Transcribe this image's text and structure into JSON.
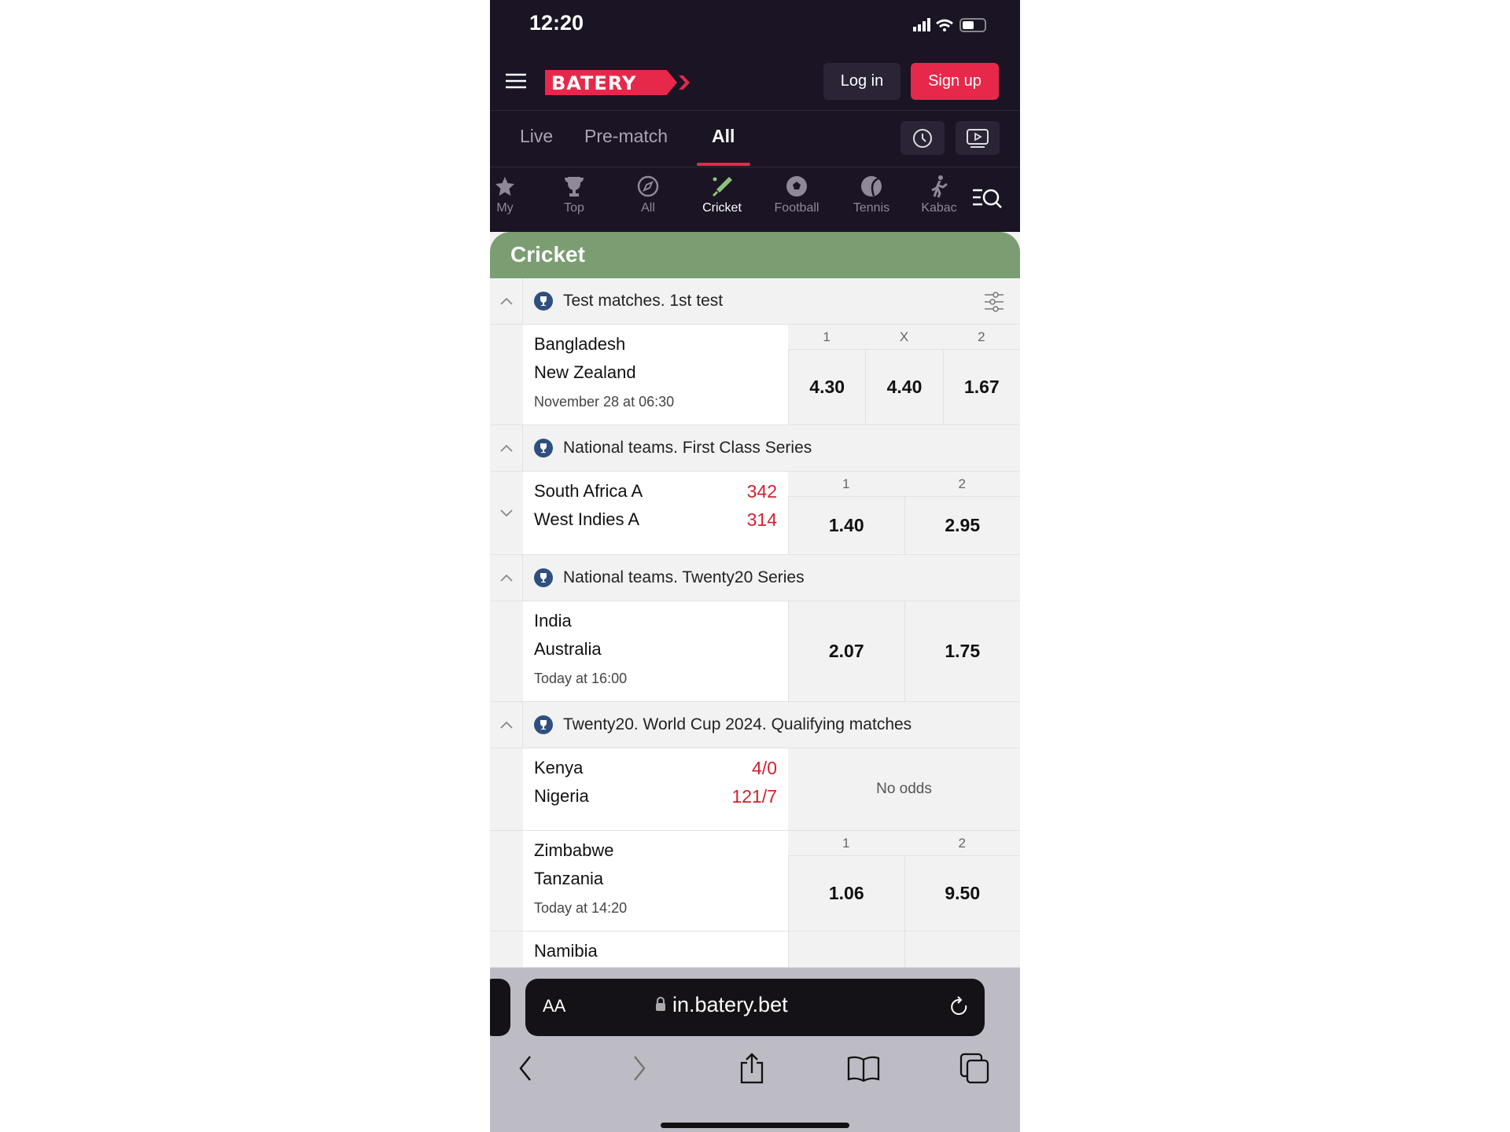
{
  "status": {
    "time": "12:20"
  },
  "header": {
    "logo": "BATERY",
    "login": "Log in",
    "signup": "Sign up"
  },
  "tabs": [
    {
      "label": "Live"
    },
    {
      "label": "Pre-match"
    },
    {
      "label": "All",
      "active": true
    }
  ],
  "sports": [
    {
      "label": "My",
      "icon": "star-icon"
    },
    {
      "label": "Top",
      "icon": "trophy-icon"
    },
    {
      "label": "All",
      "icon": "compass-icon"
    },
    {
      "label": "Cricket",
      "icon": "cricket-bat-icon",
      "active": true
    },
    {
      "label": "Football",
      "icon": "football-icon"
    },
    {
      "label": "Tennis",
      "icon": "tennis-ball-icon"
    },
    {
      "label": "Kabac",
      "icon": "kabaddi-icon"
    }
  ],
  "category": "Cricket",
  "sections": [
    {
      "title": "Test matches. 1st test",
      "filter": true,
      "matches": [
        {
          "team1": "Bangladesh",
          "team2": "New Zealand",
          "date": "November 28 at 06:30",
          "labels": [
            "1",
            "X",
            "2"
          ],
          "odds": [
            "4.30",
            "4.40",
            "1.67"
          ]
        }
      ]
    },
    {
      "title": "National teams. First Class Series",
      "matches": [
        {
          "team1": "South Africa A",
          "team2": "West Indies A",
          "score1": "342",
          "score2": "314",
          "labels": [
            "1",
            "2"
          ],
          "odds": [
            "1.40",
            "2.95"
          ],
          "expand": true
        }
      ]
    },
    {
      "title": "National teams. Twenty20 Series",
      "matches": [
        {
          "team1": "India",
          "team2": "Australia",
          "date": "Today at 16:00",
          "odds": [
            "2.07",
            "1.75"
          ]
        }
      ]
    },
    {
      "title": "Twenty20. World Cup 2024. Qualifying matches",
      "matches": [
        {
          "team1": "Kenya",
          "team2": "Nigeria",
          "score1": "4/0",
          "score2": "121/7",
          "noodds": "No odds"
        },
        {
          "team1": "Zimbabwe",
          "team2": "Tanzania",
          "date": "Today at 14:20",
          "labels": [
            "1",
            "2"
          ],
          "odds": [
            "1.06",
            "9.50"
          ]
        },
        {
          "team1": "Namibia",
          "odds": [
            "",
            ""
          ]
        }
      ]
    }
  ],
  "browser": {
    "text_size": "AA",
    "url": "in.batery.bet"
  },
  "colors": {
    "brand": "#e8284a",
    "header_bg": "#1a1424",
    "category": "#7a9d71",
    "score": "#d3202f"
  }
}
